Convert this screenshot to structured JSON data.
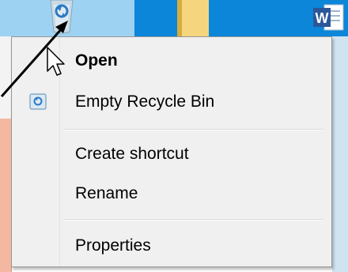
{
  "desktop": {
    "recycle_bin_icon": "recycle-bin-icon",
    "folder_icon": "folder-icon",
    "word_icon": "word-icon",
    "word_letter": "W"
  },
  "context_menu": {
    "items": [
      {
        "label": "Open",
        "bold": true
      },
      {
        "label": "Empty Recycle Bin",
        "icon": "recycle-bin-small-icon"
      },
      {
        "label": "Create shortcut"
      },
      {
        "label": "Rename"
      },
      {
        "label": "Properties"
      }
    ]
  },
  "colors": {
    "desktop_blue": "#0b86d8",
    "menu_bg": "#f0f0f0",
    "peach": "#f4b8a2"
  }
}
